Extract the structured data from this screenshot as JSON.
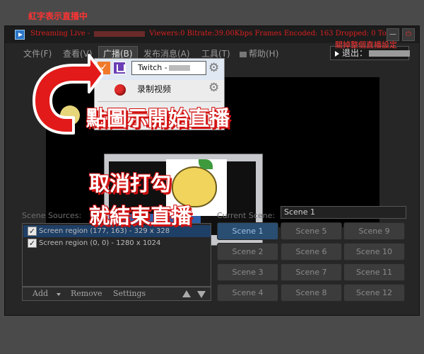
{
  "annotations": {
    "top_label": "紅字表示直播中",
    "right_label": "關掉整個直播設定",
    "click_icon": "點圖示開始直播",
    "uncheck_line1": "取消打勾",
    "uncheck_line2": "就結束直播"
  },
  "window": {
    "title_prefix": "Streaming Live -",
    "title_stats": "Viewers:0 Bitrate:39.00Kbps Frames Encoded: 163 Dropped: 0 Total",
    "title_color": "#d92020"
  },
  "menu": {
    "items": [
      "文件(F)",
      "查看(V)",
      "广播(B)",
      "发布消息(A)",
      "工具(T)",
      "帮助(H)"
    ],
    "exit_label": "退出："
  },
  "broadcast_menu": {
    "twitch_label": "Twitch -",
    "record_label": "录制视频",
    "checked": true
  },
  "sources": {
    "label": "Scene Sources:",
    "items": [
      {
        "label": "Screen region (177, 163) - 329 x 328",
        "checked": true
      },
      {
        "label": "Screen region (0, 0) - 1280 x 1024",
        "checked": true
      }
    ],
    "add_label": "Add",
    "remove_label": "Remove",
    "settings_label": "Settings"
  },
  "scenes": {
    "current_label": "Current Scene:",
    "current_value": "Scene 1",
    "buttons": [
      "Scene 1",
      "Scene 5",
      "Scene 9",
      "Scene 2",
      "Scene 6",
      "Scene 10",
      "Scene 3",
      "Scene 7",
      "Scene 11",
      "Scene 4",
      "Scene 8",
      "Scene 12"
    ],
    "selected": "Scene 1"
  }
}
